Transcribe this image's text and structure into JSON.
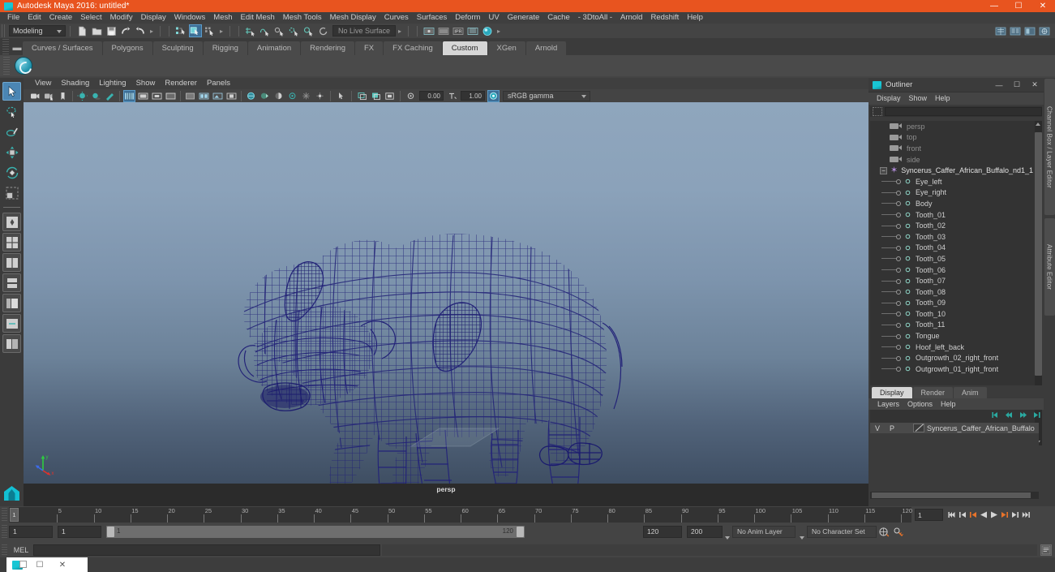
{
  "window": {
    "title": "Autodesk Maya 2016: untitled*",
    "logo_icon": "maya-logo-icon",
    "minimize_label": "—",
    "maximize_label": "☐",
    "close_label": "✕"
  },
  "menubar": {
    "items": [
      "File",
      "Edit",
      "Create",
      "Select",
      "Modify",
      "Display",
      "Windows",
      "Mesh",
      "Edit Mesh",
      "Mesh Tools",
      "Mesh Display",
      "Curves",
      "Surfaces",
      "Deform",
      "UV",
      "Generate",
      "Cache",
      "- 3DtoAll -",
      "Arnold",
      "Redshift",
      "Help"
    ]
  },
  "statusbar": {
    "mode_selector": "Modeling",
    "live_surface": "No Live Surface",
    "file_icons": [
      "new-scene-icon",
      "open-scene-icon",
      "save-scene-icon",
      "undo-icon",
      "redo-icon"
    ],
    "selection_mask_icons": [
      "select-by-hierarchy-icon",
      "select-by-object-type-icon",
      "select-by-component-type-icon"
    ],
    "snap_icons": [
      "snap-to-grid-icon",
      "snap-to-curve-icon",
      "snap-to-point-icon",
      "snap-to-projected-center-icon",
      "snap-to-view-plane-icon",
      "make-live-icon"
    ],
    "render_icons": [
      "render-current-frame-icon",
      "render-sequence-icon",
      "ipr-render-icon",
      "render-settings-icon",
      "hypershade-icon"
    ],
    "right_icons": [
      "show-hide-modeling-toolkit-icon",
      "show-hide-attribute-editor-icon",
      "show-hide-tool-settings-icon",
      "show-hide-channel-box-icon"
    ]
  },
  "shelf": {
    "tabs": [
      "Curves / Surfaces",
      "Polygons",
      "Sculpting",
      "Rigging",
      "Animation",
      "Rendering",
      "FX",
      "FX Caching",
      "Custom",
      "XGen",
      "Arnold"
    ],
    "active_tab": "Custom",
    "button_icon": "mash-tool-icon"
  },
  "toolbox": {
    "items": [
      {
        "name": "select-tool",
        "selected": true
      },
      {
        "name": "lasso-select-tool",
        "selected": false
      },
      {
        "name": "paint-select-tool",
        "selected": false
      },
      {
        "name": "move-tool",
        "selected": false
      },
      {
        "name": "rotate-tool",
        "selected": false
      },
      {
        "name": "scale-tool",
        "selected": false
      },
      {
        "name": "last-tool-used",
        "selected": false
      }
    ],
    "layout_items": [
      "single-perspective-view-icon",
      "four-view-layout-icon",
      "two-pane-side-by-side-icon",
      "two-pane-stacked-icon",
      "outliner-persp-layout-icon",
      "hypergraph-persp-layout-icon",
      "persp-graph-editor-icon"
    ],
    "badge_icon": "maya-logo-badge"
  },
  "viewport": {
    "menus": [
      "View",
      "Shading",
      "Lighting",
      "Show",
      "Renderer",
      "Panels"
    ],
    "camera_label": "persp",
    "exposure_value": "0.00",
    "gamma_value": "1.00",
    "color_space": "sRGB gamma",
    "toolbar_icons": [
      "select-camera-icon",
      "camera-attributes-icon",
      "bookmark-icon",
      "image-plane-icon",
      "two-sided-lighting-icon",
      "shadows-icon",
      "grid-toggle-icon",
      "film-gate-icon",
      "resolution-gate-icon",
      "gate-mask-icon",
      "wireframe-shading-icon",
      "smooth-shade-all-icon",
      "smooth-shade-textured-icon",
      "use-default-material-icon",
      "xray-icon",
      "xray-joints-icon",
      "xray-active-components-icon",
      "exposure-icon",
      "gamma-icon",
      "color-management-icon"
    ],
    "axis_gizmo": {
      "x": "x",
      "y": "y",
      "z": "z"
    },
    "background": {
      "top": "#8fa6bd",
      "bottom": "#3b4a5e"
    },
    "wireframe_color": "#232378",
    "model_name": "African Buffalo wireframe model"
  },
  "outliner": {
    "title": "Outliner",
    "icon": "outliner-icon",
    "menus": [
      "Display",
      "Show",
      "Help"
    ],
    "search_value": "",
    "cameras": [
      "persp",
      "top",
      "front",
      "side"
    ],
    "group": {
      "name": "Syncerus_Caffer_African_Buffalo_nd1_1",
      "expanded": true
    },
    "children": [
      "Eye_left",
      "Eye_right",
      "Body",
      "Tooth_01",
      "Tooth_02",
      "Tooth_03",
      "Tooth_04",
      "Tooth_05",
      "Tooth_06",
      "Tooth_07",
      "Tooth_08",
      "Tooth_09",
      "Tooth_10",
      "Tooth_11",
      "Tongue",
      "Hoof_left_back",
      "Outgrowth_02_right_front",
      "Outgrowth_01_right_front"
    ]
  },
  "channel_panel": {
    "tabs": [
      "Display",
      "Render",
      "Anim"
    ],
    "active_tab": "Display",
    "menus": [
      "Layers",
      "Options",
      "Help"
    ],
    "layer_buttons": [
      "layer-first-icon",
      "layer-prev-icon",
      "layer-next-icon",
      "layer-last-icon"
    ],
    "columns": [
      "V",
      "P"
    ],
    "layers": [
      {
        "name": "Syncerus_Caffer_African_Buffalo",
        "visible": "",
        "playback": ""
      }
    ]
  },
  "right_dock": {
    "tabs": [
      "Channel Box / Layer Editor",
      "Attribute Editor"
    ]
  },
  "timeline": {
    "current_frame": "1",
    "start_display": "1",
    "ticks": [
      "5",
      "10",
      "15",
      "20",
      "25",
      "30",
      "35",
      "40",
      "45",
      "50",
      "55",
      "60",
      "65",
      "70",
      "75",
      "80",
      "85",
      "90",
      "95",
      "100",
      "105",
      "110",
      "115",
      "120"
    ],
    "frame_field": "1",
    "playback_buttons": [
      "go-to-start-icon",
      "step-back-keyframe-icon",
      "step-back-frame-icon",
      "play-backwards-icon",
      "play-forwards-icon",
      "step-forward-frame-icon",
      "step-forward-keyframe-icon",
      "go-to-end-icon"
    ]
  },
  "range": {
    "anim_start": "1",
    "range_start": "1",
    "slider_start_label": "1",
    "slider_end_label": "120",
    "range_end": "120",
    "anim_end": "200",
    "anim_layer": "No Anim Layer",
    "character_set": "No Character Set",
    "auto_key_icon": "auto-keyframe-icon",
    "pref_icon": "animation-preferences-icon"
  },
  "command_line": {
    "language": "MEL",
    "value": "",
    "script_editor_icon": "script-editor-icon"
  },
  "taskbar": {
    "window_icon": "maya-taskbar-icon",
    "restore_label": "☐",
    "close_label": "✕"
  }
}
